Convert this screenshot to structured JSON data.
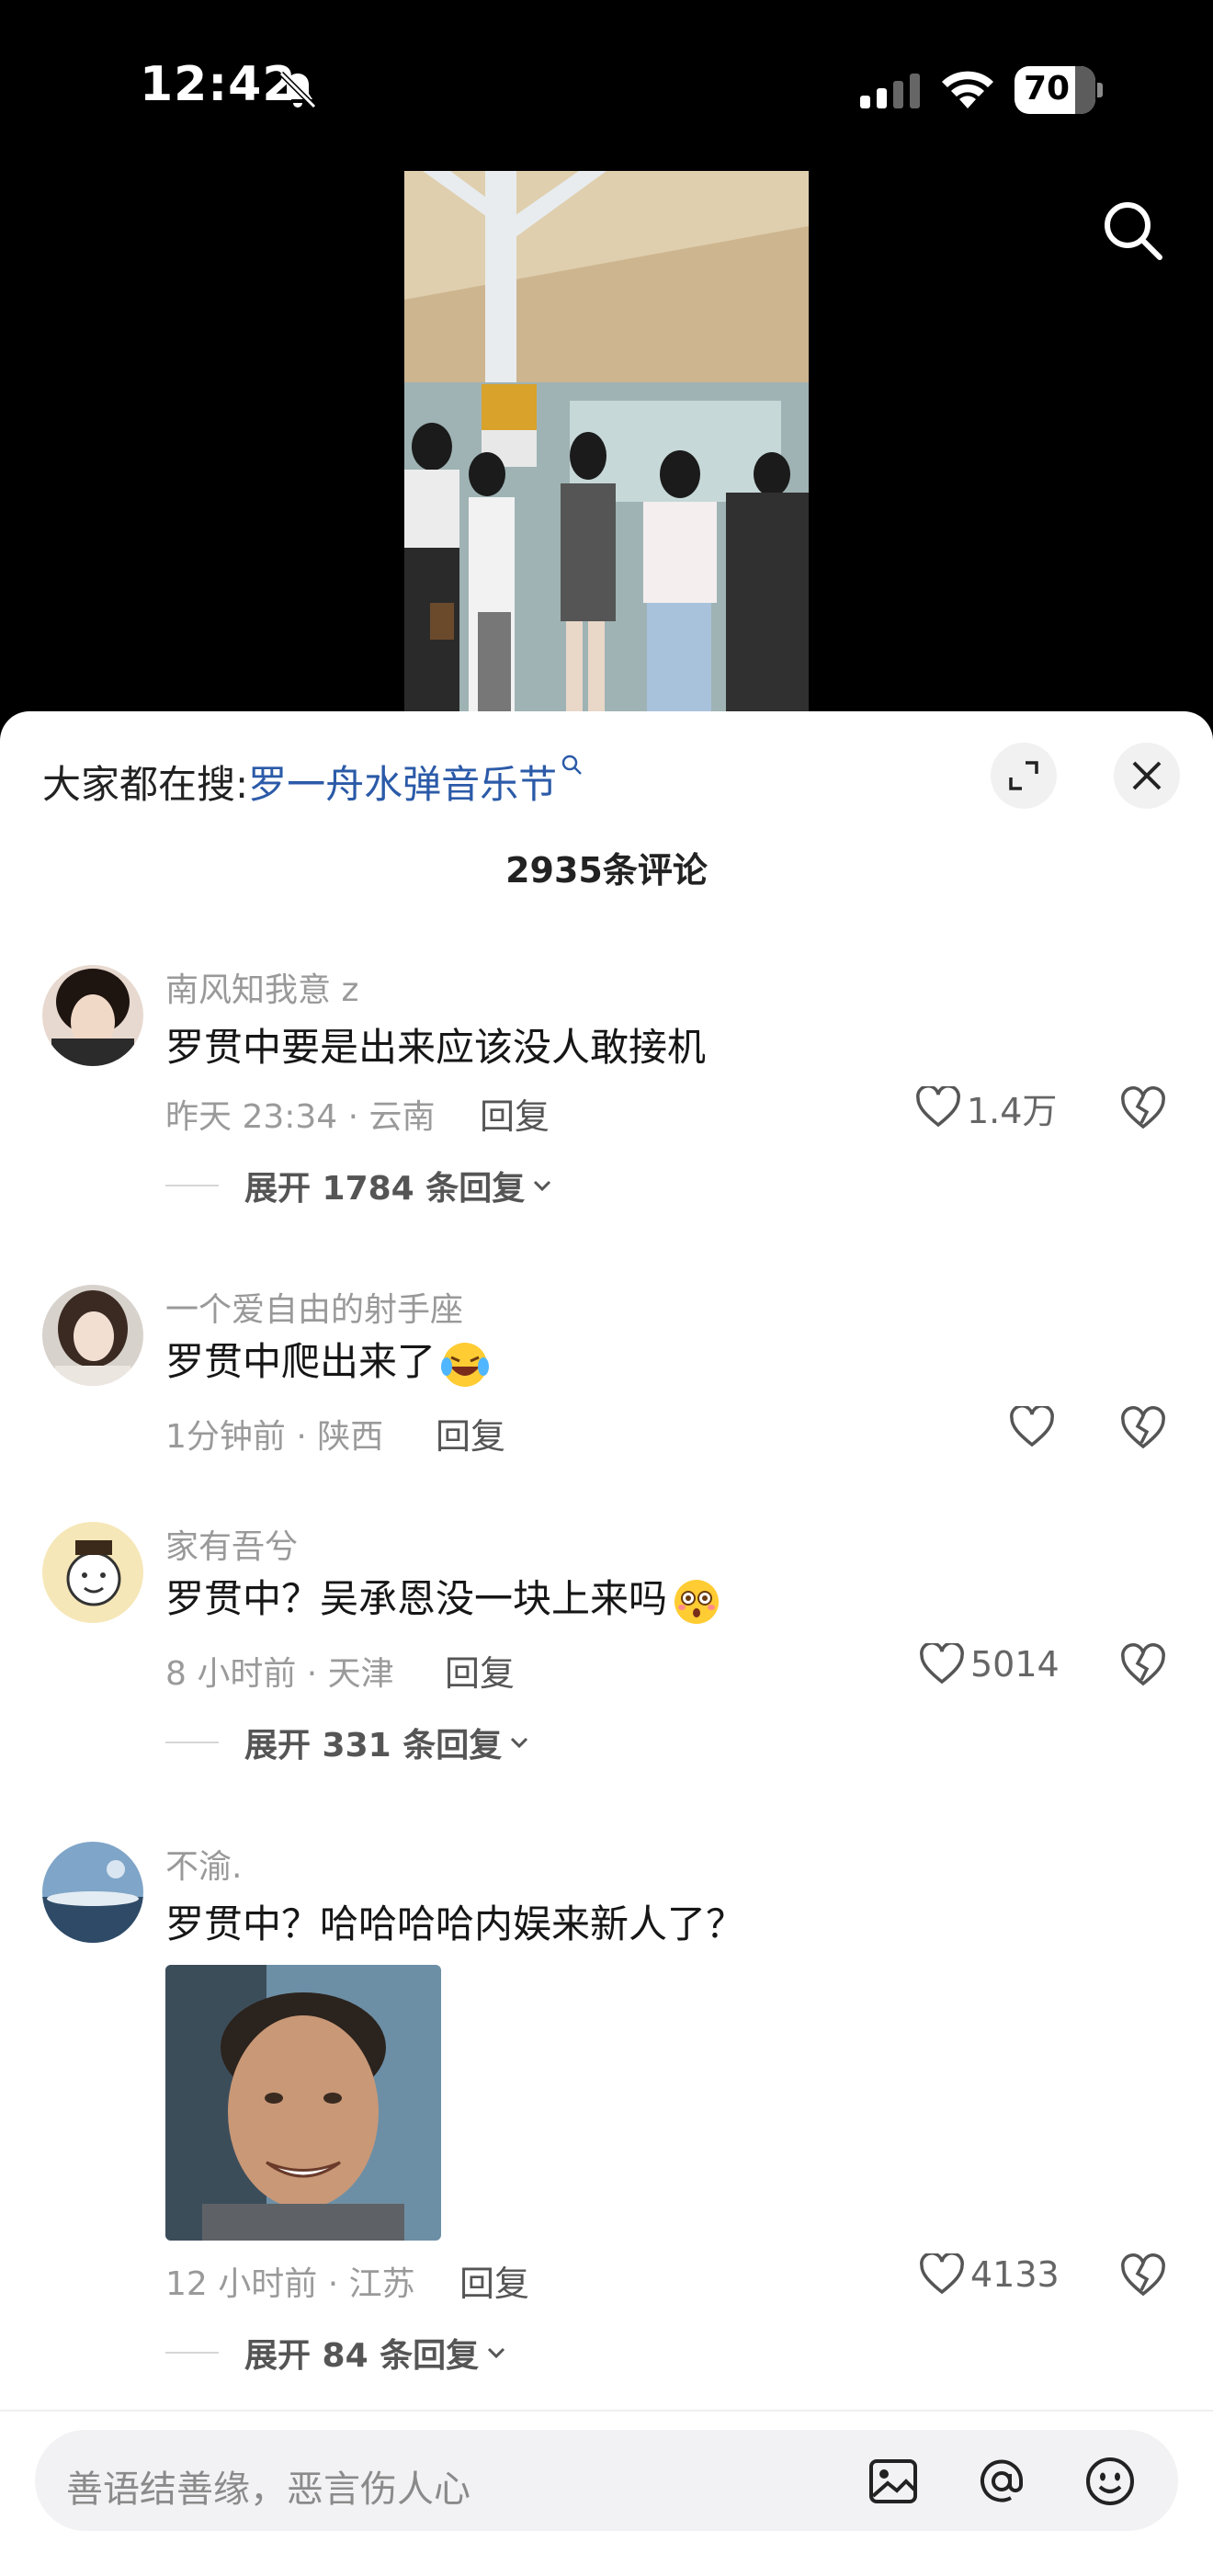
{
  "status_bar": {
    "time": "12:42",
    "battery": "70"
  },
  "header": {
    "trending_prefix": "大家都在搜:",
    "trending_query": "罗一舟水弹音乐节"
  },
  "comment_count": "2935条评论",
  "comments": [
    {
      "username": "南风知我意 z",
      "text": "罗贯中要是出来应该没人敢接机",
      "meta": "昨天 23:34 · 云南",
      "reply": "回复",
      "likes": "1.4万",
      "expand": "展开 1784 条回复"
    },
    {
      "username": "一个爱自由的射手座",
      "text": "罗贯中爬出来了",
      "emoji": "laughing-crying-emoji",
      "meta": "1分钟前 · 陕西",
      "reply": "回复",
      "likes": ""
    },
    {
      "username": "家有吾兮",
      "text": "罗贯中？吴承恩没一块上来吗",
      "emoji": "dazed-emoji",
      "meta": "8 小时前 · 天津",
      "reply": "回复",
      "likes": "5014",
      "expand": "展开 331 条回复"
    },
    {
      "username": "不渝.",
      "text": "罗贯中？哈哈哈哈内娱来新人了？",
      "meta": "12 小时前 · 江苏",
      "reply": "回复",
      "likes": "4133",
      "expand": "展开 84 条回复"
    }
  ],
  "input": {
    "placeholder": "善语结善缘，恶言伤人心"
  },
  "colors": {
    "link": "#2b5aa8",
    "sheet_bg": "#ffffff",
    "input_bg": "#f2f2f4"
  }
}
